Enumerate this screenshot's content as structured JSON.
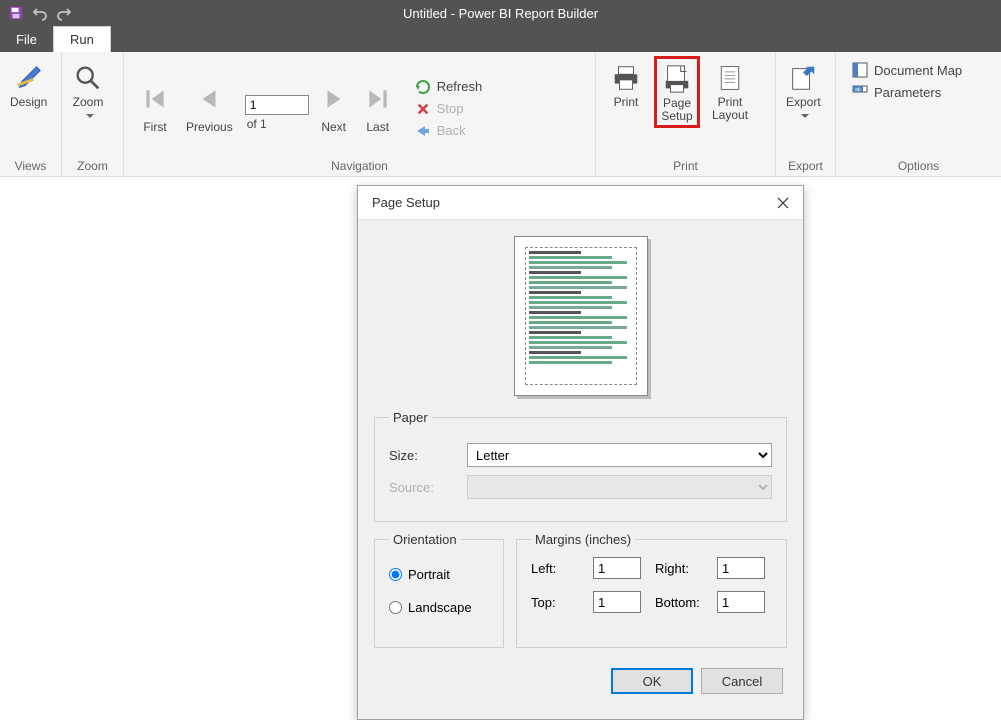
{
  "titlebar": {
    "title": "Untitled - Power BI Report Builder"
  },
  "tabs": {
    "file": "File",
    "run": "Run"
  },
  "groups": {
    "views": {
      "label": "Views",
      "design": "Design"
    },
    "zoom": {
      "label": "Zoom",
      "zoom": "Zoom"
    },
    "navigation": {
      "label": "Navigation",
      "first": "First",
      "previous": "Previous",
      "next": "Next",
      "last": "Last",
      "page_value": "1",
      "of_text": "of  1",
      "refresh": "Refresh",
      "stop": "Stop",
      "back": "Back"
    },
    "print": {
      "label": "Print",
      "print": "Print",
      "page_setup_l1": "Page",
      "page_setup_l2": "Setup",
      "print_layout_l1": "Print",
      "print_layout_l2": "Layout"
    },
    "export": {
      "label": "Export",
      "export": "Export"
    },
    "options": {
      "label": "Options",
      "document_map": "Document Map",
      "parameters": "Parameters"
    }
  },
  "dialog": {
    "title": "Page Setup",
    "paper": {
      "legend": "Paper",
      "size_label": "Size:",
      "size_value": "Letter",
      "source_label": "Source:"
    },
    "orientation": {
      "legend": "Orientation",
      "portrait": "Portrait",
      "landscape": "Landscape",
      "selected": "portrait"
    },
    "margins": {
      "legend": "Margins (inches)",
      "left_label": "Left:",
      "left_value": "1",
      "right_label": "Right:",
      "right_value": "1",
      "top_label": "Top:",
      "top_value": "1",
      "bottom_label": "Bottom:",
      "bottom_value": "1"
    },
    "buttons": {
      "ok": "OK",
      "cancel": "Cancel"
    }
  }
}
